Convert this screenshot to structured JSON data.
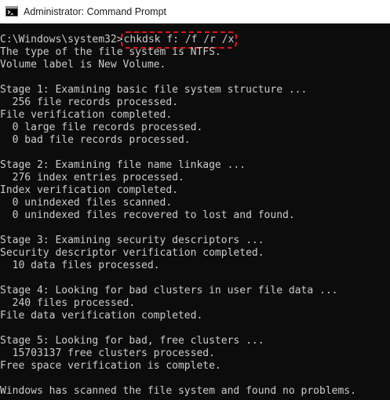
{
  "window": {
    "title": "Administrator: Command Prompt",
    "icon": "cmd-console-icon"
  },
  "console": {
    "prompt": "C:\\Windows\\system32>",
    "command": "chkdsk f: /f /r /x",
    "highlight_color": "#e0161b",
    "output": [
      "The type of the file system is NTFS.",
      "Volume label is New Volume.",
      "",
      "Stage 1: Examining basic file system structure ...",
      "  256 file records processed.",
      "File verification completed.",
      "  0 large file records processed.",
      "  0 bad file records processed.",
      "",
      "Stage 2: Examining file name linkage ...",
      "  276 index entries processed.",
      "Index verification completed.",
      "  0 unindexed files scanned.",
      "  0 unindexed files recovered to lost and found.",
      "",
      "Stage 3: Examining security descriptors ...",
      "Security descriptor verification completed.",
      "  10 data files processed.",
      "",
      "Stage 4: Looking for bad clusters in user file data ...",
      "  240 files processed.",
      "File data verification completed.",
      "",
      "Stage 5: Looking for bad, free clusters ...",
      "  15703137 free clusters processed.",
      "Free space verification is complete.",
      "",
      "Windows has scanned the file system and found no problems."
    ]
  }
}
